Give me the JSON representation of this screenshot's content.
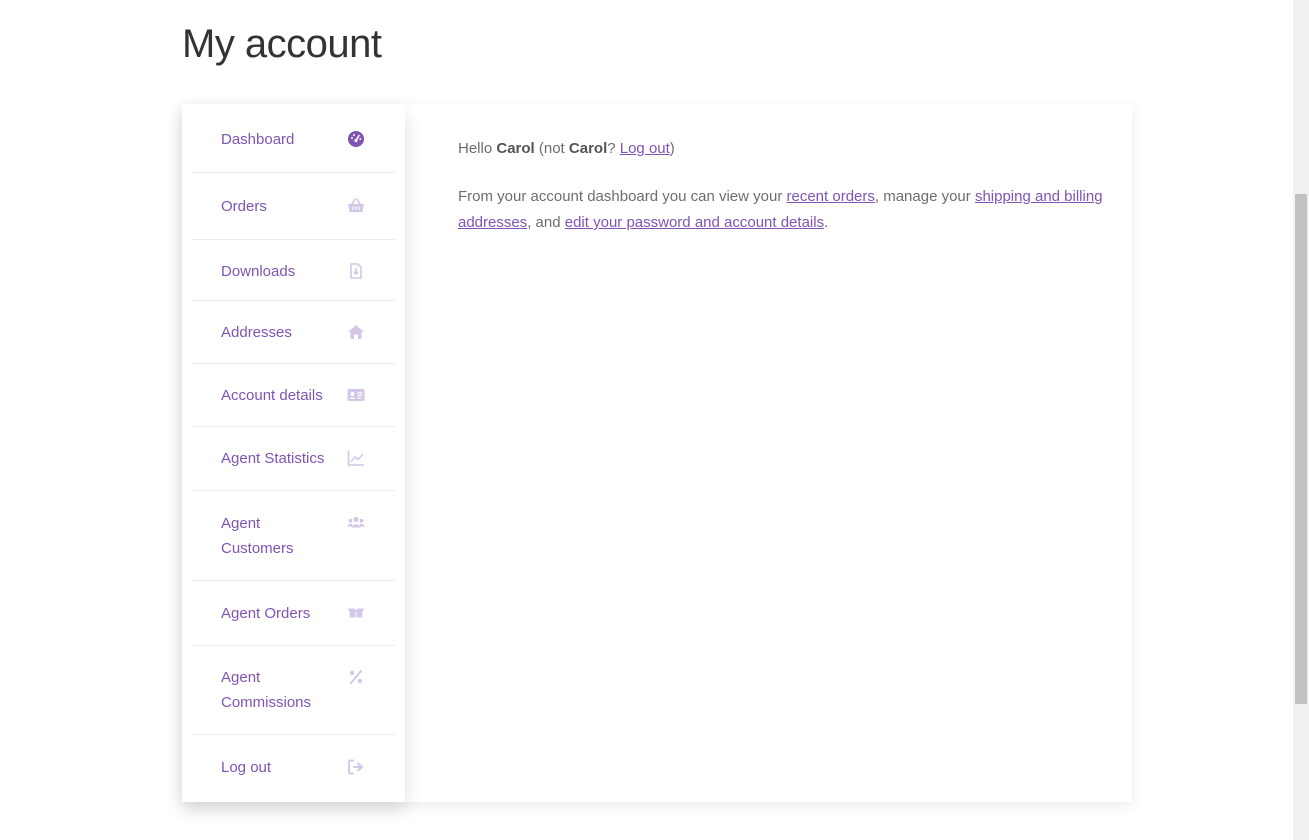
{
  "page": {
    "title": "My account"
  },
  "nav": {
    "items": [
      {
        "label": "Dashboard",
        "icon": "dashboard-icon",
        "active": true
      },
      {
        "label": "Orders",
        "icon": "basket-icon"
      },
      {
        "label": "Downloads",
        "icon": "file-download-icon"
      },
      {
        "label": "Addresses",
        "icon": "home-icon"
      },
      {
        "label": "Account details",
        "icon": "id-card-icon"
      },
      {
        "label": "Agent Statistics",
        "icon": "chart-line-icon"
      },
      {
        "label": "Agent Customers",
        "icon": "users-icon"
      },
      {
        "label": "Agent Orders",
        "icon": "boxes-icon"
      },
      {
        "label": "Agent Commissions",
        "icon": "percent-icon"
      },
      {
        "label": "Log out",
        "icon": "sign-out-icon"
      }
    ]
  },
  "greeting": {
    "hello": "Hello ",
    "name": "Carol",
    "not_prefix": " (not ",
    "not_name": "Carol",
    "question": "? ",
    "logout_link": "Log out",
    "close": ")"
  },
  "dashboard_text": {
    "part1": "From your account dashboard you can view your ",
    "recent_orders_link": "recent orders",
    "part2": ", manage your ",
    "addresses_link": "shipping and billing addresses",
    "part3": ", and ",
    "account_link": "edit your password and account details",
    "part4": "."
  },
  "colors": {
    "accent": "#7f54b3",
    "icon_light": "#d4c6e7",
    "icon_active": "#7f54b3",
    "text": "#6d6d6d"
  }
}
